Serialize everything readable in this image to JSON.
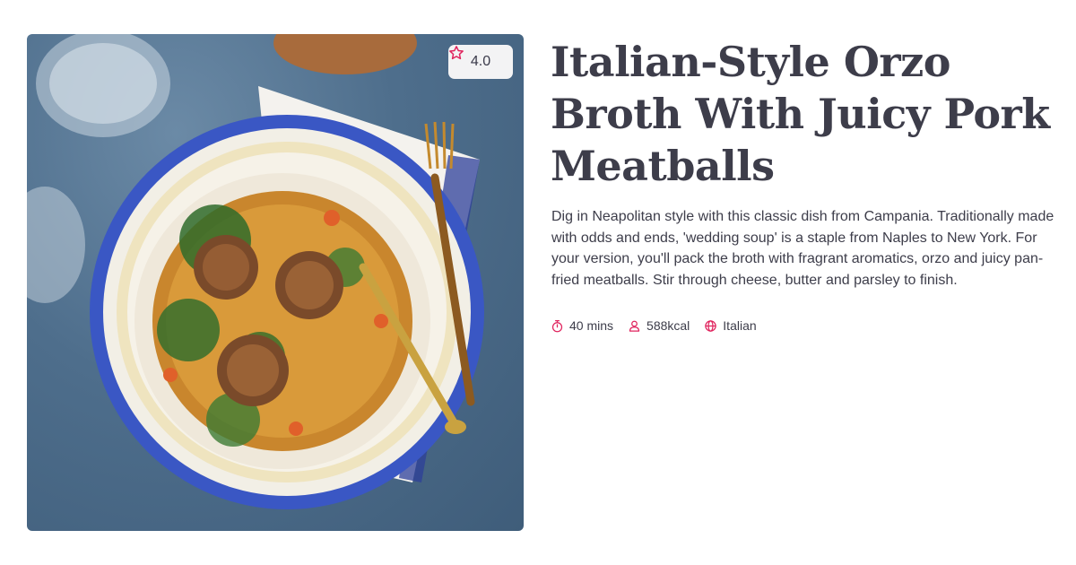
{
  "recipe": {
    "title": "Italian-Style Orzo Broth With Juicy Pork Meatballs",
    "description": "Dig in Neapolitan style with this classic dish from Campania. Traditionally made with odds and ends, 'wedding soup' is a staple from Naples to New York. For your version, you'll pack the broth with fragrant aromatics, orzo and juicy pan-fried meatballs. Stir through cheese, butter and parsley to finish.",
    "rating": "4.0",
    "meta": {
      "time": "40 mins",
      "calories": "588kcal",
      "cuisine": "Italian"
    },
    "icons": {
      "rating": "star-icon",
      "time": "stopwatch-icon",
      "calories": "person-icon",
      "cuisine": "globe-icon"
    }
  },
  "colors": {
    "accent": "#e0245e",
    "text": "#3d3d4a",
    "badge_bg": "#f3f3f4"
  }
}
